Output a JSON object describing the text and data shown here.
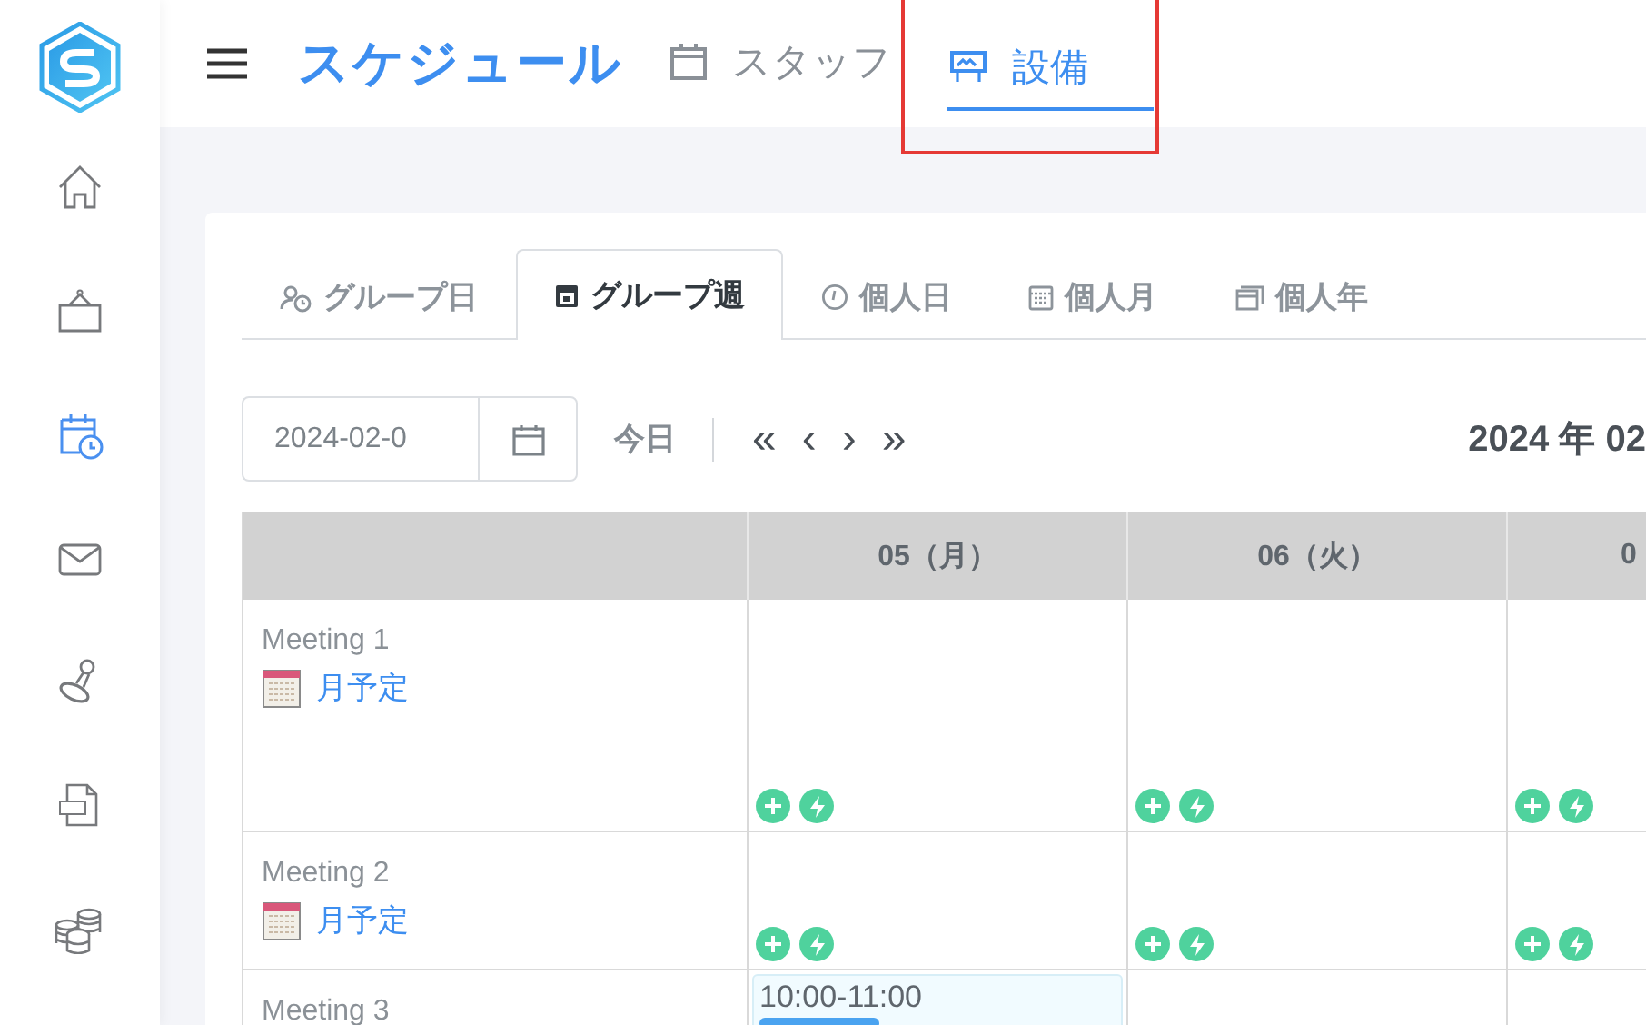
{
  "sidebar": {
    "items": [
      {
        "kind": "home",
        "selected": false
      },
      {
        "kind": "bag",
        "selected": false
      },
      {
        "kind": "calendar-clock",
        "selected": true
      },
      {
        "kind": "mail",
        "selected": false
      },
      {
        "kind": "stamp",
        "selected": false
      },
      {
        "kind": "pdf",
        "selected": false
      },
      {
        "kind": "coins",
        "selected": false
      }
    ]
  },
  "header": {
    "title": "スケジュール",
    "nav": [
      {
        "label": "スタッフ",
        "kind": "calendar",
        "selected": false,
        "highlighted": false
      },
      {
        "label": "設備",
        "kind": "board",
        "selected": true,
        "highlighted": true
      }
    ]
  },
  "view_tabs": [
    {
      "label": "グループ日",
      "kind": "group",
      "selected": false
    },
    {
      "label": "グループ週",
      "kind": "week",
      "selected": true
    },
    {
      "label": "個人日",
      "kind": "clock",
      "selected": false
    },
    {
      "label": "個人月",
      "kind": "month",
      "selected": false
    },
    {
      "label": "個人年",
      "kind": "year",
      "selected": false
    }
  ],
  "toolbar": {
    "date_value": "2024-02-0",
    "today": "今日",
    "nav": [
      "«",
      "‹",
      "›",
      "»"
    ],
    "title": "2024 年 02"
  },
  "schedule": {
    "columns": [
      "05（月）",
      "06（火）",
      "0"
    ],
    "rows": [
      {
        "name": "Meeting 1",
        "link": "月予定",
        "kind": "tall",
        "cells": [
          {
            "actions": true
          },
          {
            "actions": true
          },
          {
            "actions": true
          }
        ]
      },
      {
        "name": "Meeting 2",
        "link": "月予定",
        "kind": "short",
        "cells": [
          {
            "actions": true
          },
          {
            "actions": true
          },
          {
            "actions": true
          }
        ]
      },
      {
        "name": "Meeting 3",
        "kind": "cut",
        "cells": [
          {
            "events": [
              {
                "time": "10:00-11:00"
              }
            ]
          }
        ]
      }
    ]
  }
}
